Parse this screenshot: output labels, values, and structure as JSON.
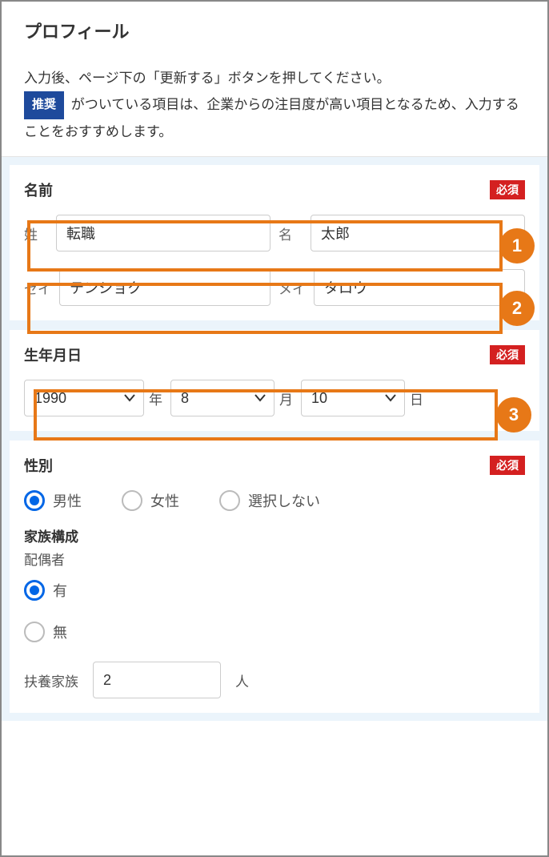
{
  "header": {
    "title": "プロフィール",
    "instruction_line1": "入力後、ページ下の「更新する」ボタンを押してください。",
    "instruction_line2_before": "",
    "badge_recommended": "推奨",
    "instruction_line2_after": "がついている項目は、企業からの注目度が高い項目となるため、入力することをおすすめします。"
  },
  "form": {
    "name_section": {
      "title": "名前",
      "required_badge": "必須",
      "sei_label": "姓",
      "sei_value": "転職",
      "mei_label": "名",
      "mei_value": "太郎",
      "sei_kana_label": "セイ",
      "sei_kana_value": "テンショク",
      "mei_kana_label": "メイ",
      "mei_kana_value": "タロウ"
    },
    "birth_section": {
      "title": "生年月日",
      "required_badge": "必須",
      "year_value": "1990",
      "year_label": "年",
      "month_value": "8",
      "month_label": "月",
      "day_value": "10",
      "day_label": "日"
    },
    "gender_section": {
      "title": "性別",
      "required_badge": "必須",
      "options": {
        "male": "男性",
        "female": "女性",
        "none": "選択しない"
      }
    },
    "family_section": {
      "title": "家族構成",
      "spouse_label": "配偶者",
      "spouse_options": {
        "yes": "有",
        "no": "無"
      },
      "dependents_label": "扶養家族",
      "dependents_value": "2",
      "dependents_unit": "人"
    }
  },
  "annotations": {
    "callouts": {
      "c1": "1",
      "c2": "2",
      "c3": "3"
    }
  }
}
